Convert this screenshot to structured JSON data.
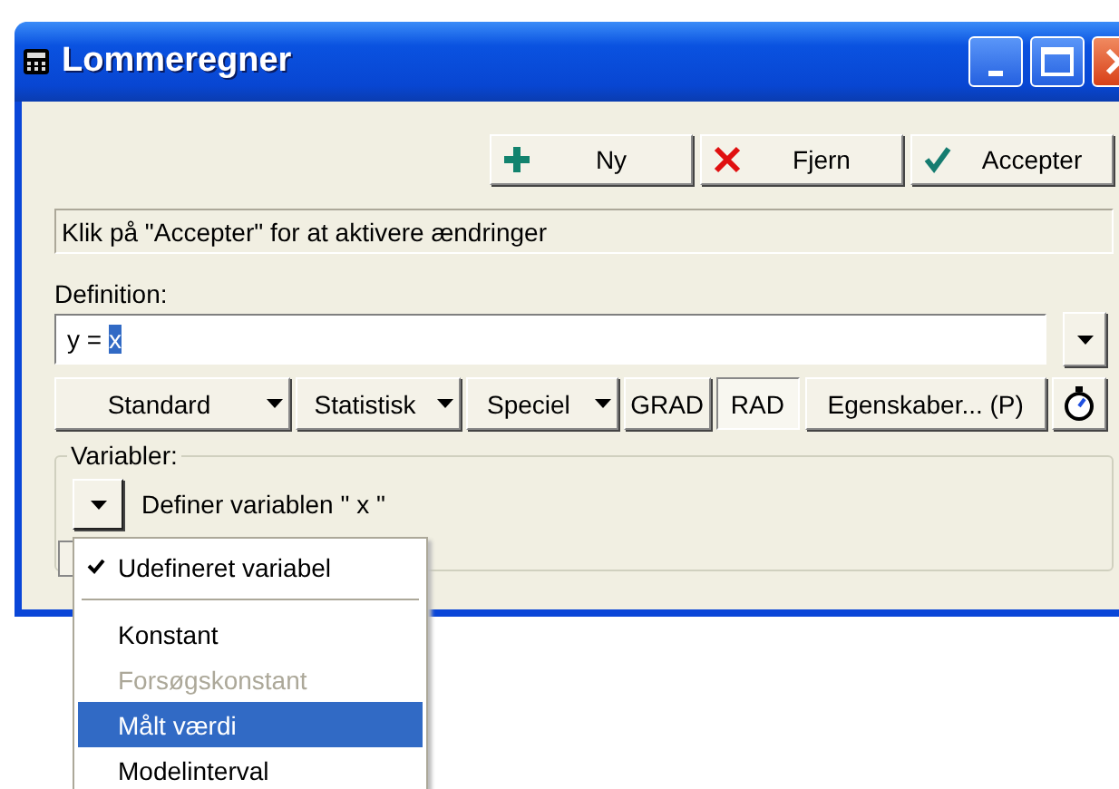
{
  "window": {
    "title": "Lommeregner"
  },
  "actions": [
    {
      "label": "Ny",
      "kind": "plus"
    },
    {
      "label": "Fjern",
      "kind": "cross"
    },
    {
      "label": "Accepter",
      "kind": "check"
    }
  ],
  "message": "Klik på \"Accepter\" for at aktivere ændringer",
  "definition": {
    "label": "Definition:",
    "value": "y = ",
    "selected_text": "x"
  },
  "toolbar": [
    {
      "kind": "menu",
      "label": "Standard"
    },
    {
      "kind": "menu",
      "label": "Statistisk"
    },
    {
      "kind": "menu",
      "label": "Speciel"
    },
    {
      "kind": "toggle",
      "label": "GRAD",
      "selected": false
    },
    {
      "kind": "toggle",
      "label": "RAD",
      "selected": true
    },
    {
      "kind": "button",
      "label": "Egenskaber... (P)"
    },
    {
      "kind": "timer"
    }
  ],
  "variables": {
    "label": "Variabler:",
    "text": "Definer variablen \" x \""
  },
  "menu": [
    {
      "kind": "item",
      "label": "Udefineret variabel",
      "checked": true,
      "disabled": false,
      "selected": false
    },
    {
      "kind": "separator"
    },
    {
      "kind": "item",
      "label": "Konstant",
      "checked": false,
      "disabled": false,
      "selected": false
    },
    {
      "kind": "item",
      "label": "Forsøgskonstant",
      "checked": false,
      "disabled": true,
      "selected": false
    },
    {
      "kind": "item",
      "label": "Målt værdi",
      "checked": false,
      "disabled": false,
      "selected": true
    },
    {
      "kind": "item",
      "label": "Modelinterval",
      "checked": false,
      "disabled": false,
      "selected": false
    }
  ]
}
